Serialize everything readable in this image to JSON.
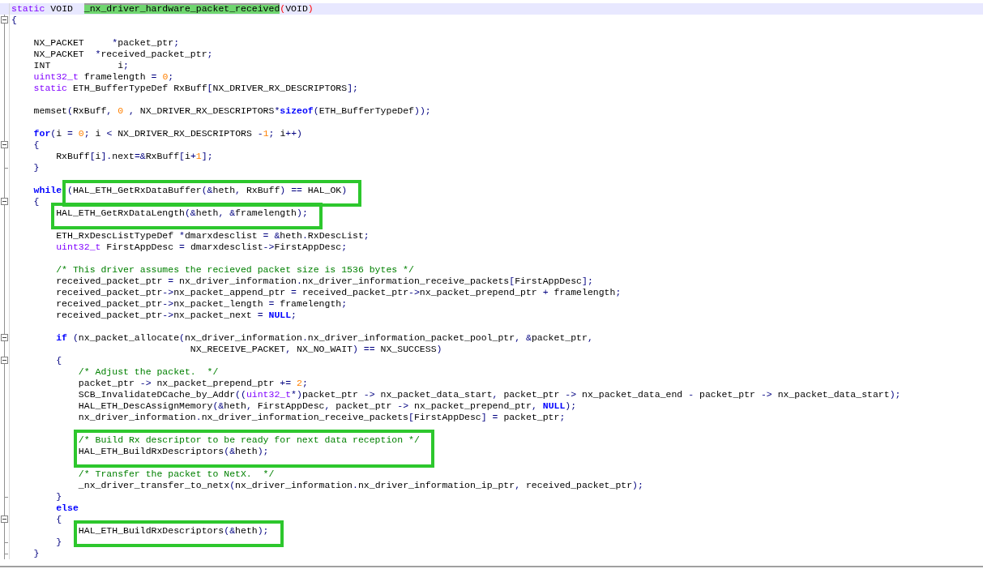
{
  "editor": {
    "lines": [
      {
        "kind": "code",
        "current": true,
        "segments": [
          {
            "text": "static",
            "kind": "type"
          },
          {
            "text": " VOID  ",
            "kind": "code"
          },
          {
            "text": "_nx_driver_hardware_packet_received",
            "kind": "match"
          },
          {
            "text": "(",
            "kind": "brace"
          },
          {
            "text": "VOID",
            "kind": "code"
          },
          {
            "text": ")",
            "kind": "brace"
          }
        ]
      },
      {
        "kind": "code",
        "collapsible": true,
        "segments": [
          {
            "text": "{",
            "kind": "code"
          }
        ]
      },
      {
        "kind": "blank"
      },
      {
        "kind": "code",
        "segments": [
          {
            "text": "    NX_PACKET     *packet_ptr;",
            "kind": "code"
          }
        ]
      },
      {
        "kind": "code",
        "segments": [
          {
            "text": "    NX_PACKET  *received_packet_ptr;",
            "kind": "code"
          }
        ]
      },
      {
        "kind": "code",
        "segments": [
          {
            "text": "    INT",
            "kind": "code"
          },
          {
            "text": "            i;",
            "kind": "code"
          }
        ]
      },
      {
        "kind": "code",
        "segments": [
          {
            "text": "    uint32_t",
            "kind": "type"
          },
          {
            "text": " framelength = 0;",
            "kind": "code"
          }
        ]
      },
      {
        "kind": "code",
        "segments": [
          {
            "text": "    static",
            "kind": "type"
          },
          {
            "text": " ETH_BufferTypeDef RxBuff[NX_DRIVER_RX_DESCRIPTORS];",
            "kind": "code"
          }
        ]
      },
      {
        "kind": "blank"
      },
      {
        "kind": "code",
        "segments": [
          {
            "text": "    memset(RxBuff, 0 , NX_DRIVER_RX_DESCRIPTORS*",
            "kind": "code"
          },
          {
            "text": "sizeof",
            "kind": "keyword"
          },
          {
            "text": "(ETH_BufferTypeDef));",
            "kind": "code"
          }
        ]
      },
      {
        "kind": "blank"
      },
      {
        "kind": "code",
        "segments": [
          {
            "text": "    for",
            "kind": "keyword"
          },
          {
            "text": "(i = 0; i < NX_DRIVER_RX_DESCRIPTORS -1; i++)",
            "kind": "code"
          }
        ]
      },
      {
        "kind": "code",
        "collapsible": true,
        "segments": [
          {
            "text": "    {",
            "kind": "code"
          }
        ]
      },
      {
        "kind": "code",
        "segments": [
          {
            "text": "        RxBuff[i].next=&RxBuff[i+1];",
            "kind": "code"
          }
        ]
      },
      {
        "kind": "code",
        "fold_end": true,
        "segments": [
          {
            "text": "    }",
            "kind": "code"
          }
        ]
      },
      {
        "kind": "blank"
      },
      {
        "kind": "code",
        "segments": [
          {
            "text": "    while ",
            "kind": "keyword"
          },
          {
            "text": "(HAL_ETH_GetRxDataBuffer(&heth, RxBuff) == HAL_OK)",
            "kind": "code",
            "boxed": true
          }
        ]
      },
      {
        "kind": "code",
        "collapsible": true,
        "segments": [
          {
            "text": "    {",
            "kind": "code"
          }
        ]
      },
      {
        "kind": "code",
        "segments": [
          {
            "text": "        HAL_ETH_GetRxDataLength(&heth, &framelength);",
            "kind": "code",
            "boxed": true
          }
        ]
      },
      {
        "kind": "blank"
      },
      {
        "kind": "code",
        "segments": [
          {
            "text": "        ETH_RxDescListTypeDef *dmarxdesclist = &heth.RxDescList;",
            "kind": "code"
          }
        ]
      },
      {
        "kind": "code",
        "segments": [
          {
            "text": "        uint32_t",
            "kind": "type"
          },
          {
            "text": " FirstAppDesc = dmarxdesclist->FirstAppDesc;",
            "kind": "code"
          }
        ]
      },
      {
        "kind": "blank"
      },
      {
        "kind": "code",
        "segments": [
          {
            "text": "        /* This driver assumes the recieved packet size is 1536 bytes */",
            "kind": "comment"
          }
        ]
      },
      {
        "kind": "code",
        "segments": [
          {
            "text": "        received_packet_ptr = nx_driver_information.nx_driver_information_receive_packets[FirstAppDesc];",
            "kind": "code"
          }
        ]
      },
      {
        "kind": "code",
        "segments": [
          {
            "text": "        received_packet_ptr->nx_packet_append_ptr = received_packet_ptr->nx_packet_prepend_ptr + framelength;",
            "kind": "code"
          }
        ]
      },
      {
        "kind": "code",
        "segments": [
          {
            "text": "        received_packet_ptr->nx_packet_length = framelength;",
            "kind": "code"
          }
        ]
      },
      {
        "kind": "code",
        "segments": [
          {
            "text": "        received_packet_ptr->nx_packet_next = ",
            "kind": "code"
          },
          {
            "text": "NULL",
            "kind": "keyword"
          },
          {
            "text": ";",
            "kind": "code"
          }
        ]
      },
      {
        "kind": "blank"
      },
      {
        "kind": "code",
        "collapsible": true,
        "segments": [
          {
            "text": "        if",
            "kind": "keyword"
          },
          {
            "text": " (nx_packet_allocate(nx_driver_information.nx_driver_information_packet_pool_ptr, &packet_ptr,",
            "kind": "code"
          }
        ]
      },
      {
        "kind": "code",
        "segments": [
          {
            "text": "                                NX_RECEIVE_PACKET, NX_NO_WAIT) == NX_SUCCESS)",
            "kind": "code"
          }
        ]
      },
      {
        "kind": "code",
        "collapsible": true,
        "segments": [
          {
            "text": "        {",
            "kind": "code"
          }
        ]
      },
      {
        "kind": "code",
        "segments": [
          {
            "text": "            /* Adjust the packet.  */",
            "kind": "comment"
          }
        ]
      },
      {
        "kind": "code",
        "segments": [
          {
            "text": "            packet_ptr -> nx_packet_prepend_ptr += 2;",
            "kind": "code"
          }
        ]
      },
      {
        "kind": "code",
        "segments": [
          {
            "text": "            SCB_InvalidateDCache_by_Addr((",
            "kind": "code"
          },
          {
            "text": "uint32_t",
            "kind": "type"
          },
          {
            "text": "*)packet_ptr -> nx_packet_data_start, packet_ptr -> nx_packet_data_end - packet_ptr -> nx_packet_data_start);",
            "kind": "code"
          }
        ]
      },
      {
        "kind": "code",
        "segments": [
          {
            "text": "            HAL_ETH_DescAssignMemory(&heth, FirstAppDesc, packet_ptr -> nx_packet_prepend_ptr, ",
            "kind": "code"
          },
          {
            "text": "NULL",
            "kind": "keyword"
          },
          {
            "text": ");",
            "kind": "code"
          }
        ]
      },
      {
        "kind": "code",
        "segments": [
          {
            "text": "            nx_driver_information.nx_driver_information_receive_packets[FirstAppDesc] = packet_ptr;",
            "kind": "code"
          }
        ]
      },
      {
        "kind": "blank"
      },
      {
        "kind": "code",
        "segments": [
          {
            "text": "            /* Build Rx descriptor to be ready for next data reception */",
            "kind": "comment",
            "boxed": true
          }
        ]
      },
      {
        "kind": "code",
        "segments": [
          {
            "text": "            HAL_ETH_BuildRxDescriptors(&heth);",
            "kind": "code",
            "boxed": true
          }
        ]
      },
      {
        "kind": "blank"
      },
      {
        "kind": "code",
        "segments": [
          {
            "text": "            /* Transfer the packet to NetX.  */",
            "kind": "comment"
          }
        ]
      },
      {
        "kind": "code",
        "segments": [
          {
            "text": "            _nx_driver_transfer_to_netx(nx_driver_information.nx_driver_information_ip_ptr, received_packet_ptr);",
            "kind": "code"
          }
        ]
      },
      {
        "kind": "code",
        "fold_end": true,
        "segments": [
          {
            "text": "        }",
            "kind": "code"
          }
        ]
      },
      {
        "kind": "code",
        "segments": [
          {
            "text": "        else",
            "kind": "keyword"
          }
        ]
      },
      {
        "kind": "code",
        "collapsible": true,
        "segments": [
          {
            "text": "        {",
            "kind": "code"
          }
        ]
      },
      {
        "kind": "code",
        "segments": [
          {
            "text": "            HAL_ETH_BuildRxDescriptors(&heth);",
            "kind": "code",
            "boxed": true
          }
        ]
      },
      {
        "kind": "code",
        "fold_end": true,
        "segments": [
          {
            "text": "        }",
            "kind": "code"
          }
        ]
      },
      {
        "kind": "code",
        "fold_end": true,
        "segments": [
          {
            "text": "    }",
            "kind": "code"
          }
        ]
      }
    ]
  }
}
